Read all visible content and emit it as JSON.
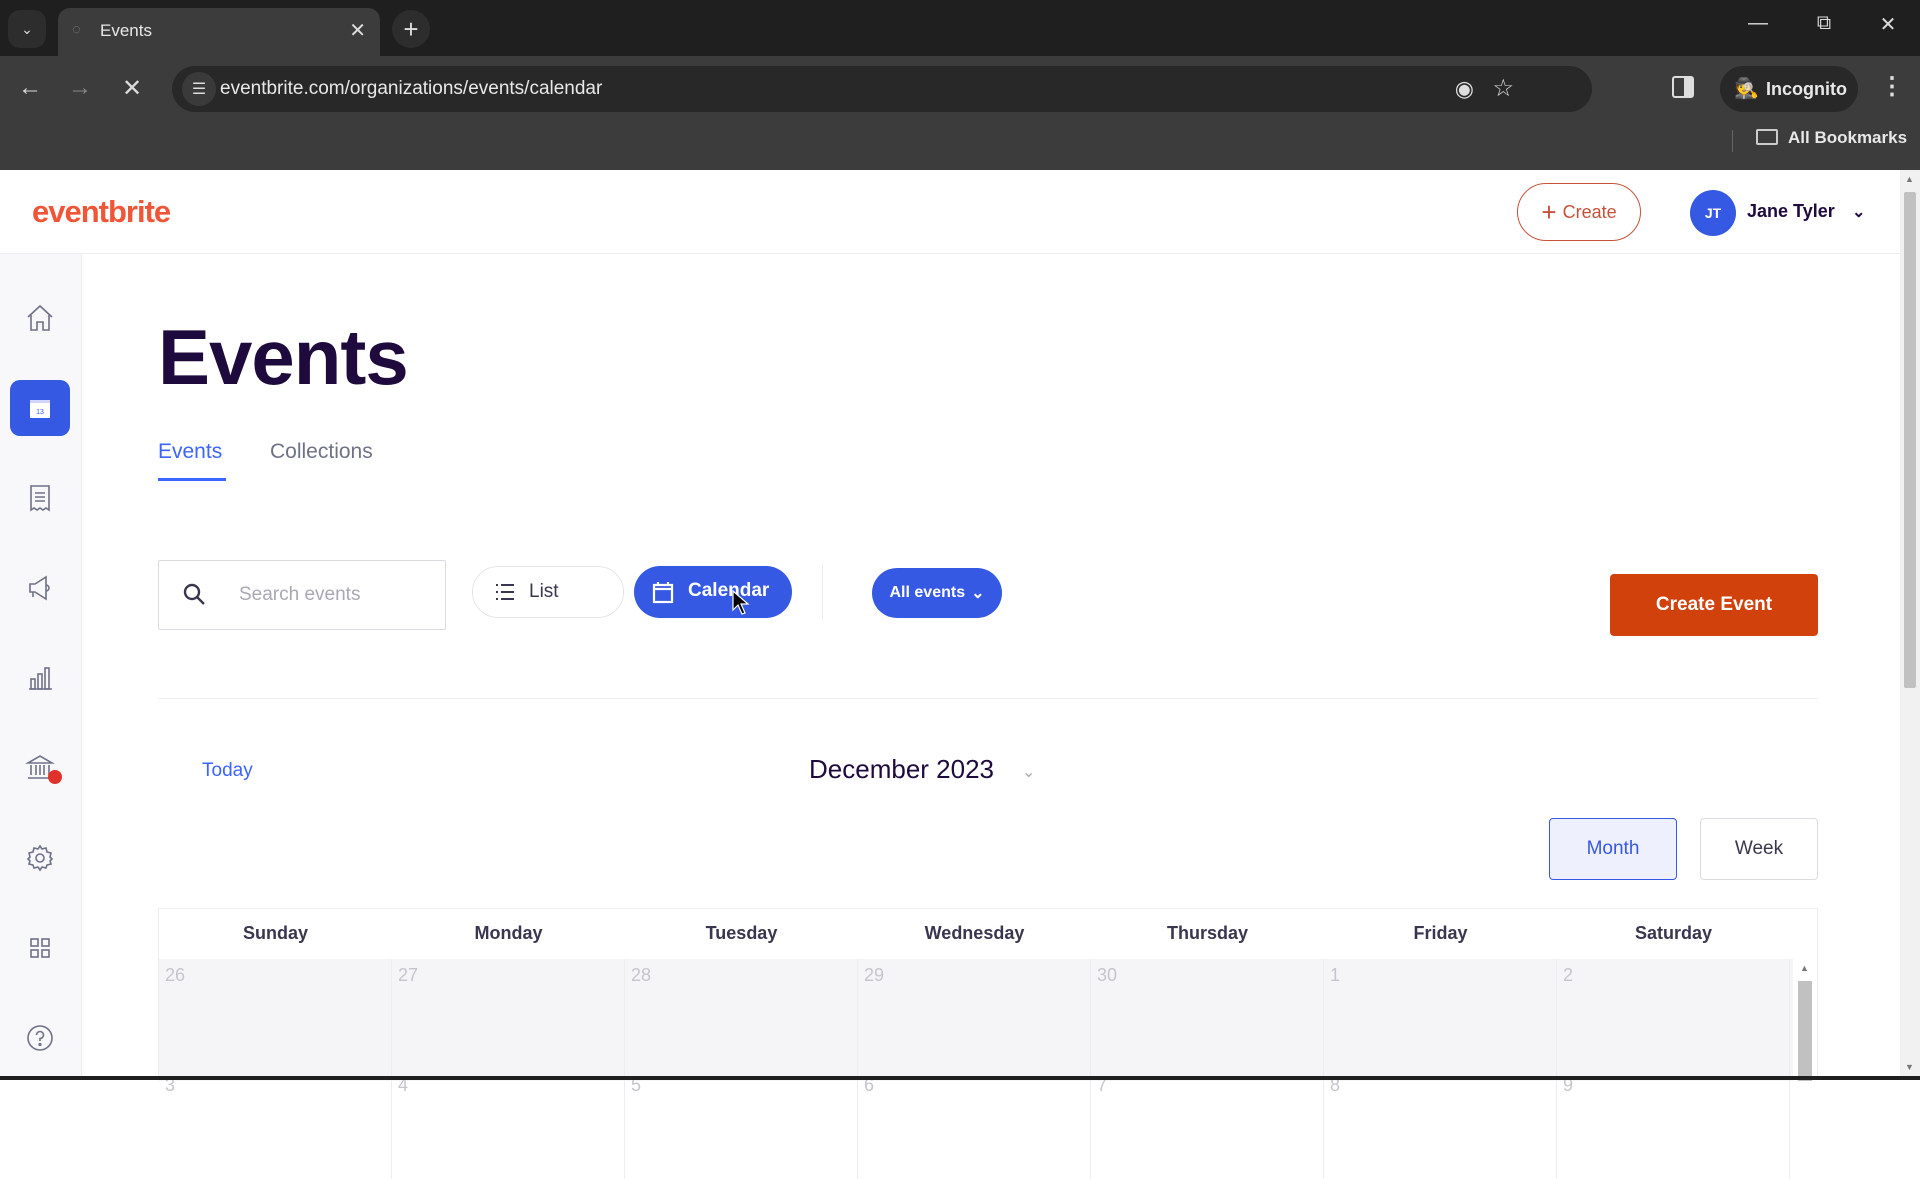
{
  "browser": {
    "tab_title": "Events",
    "url": "eventbrite.com/organizations/events/calendar",
    "profile_label": "Incognito",
    "bookmarks_label": "All Bookmarks"
  },
  "header": {
    "logo": "eventbrite",
    "create_label": "Create",
    "user_initials": "JT",
    "user_name": "Jane Tyler"
  },
  "sidebar": {
    "items": [
      {
        "name": "home",
        "icon": "home-icon",
        "active": false
      },
      {
        "name": "events",
        "icon": "calendar-icon",
        "active": true,
        "icon_text": "13"
      },
      {
        "name": "orders",
        "icon": "receipt-icon",
        "active": false
      },
      {
        "name": "marketing",
        "icon": "megaphone-icon",
        "active": false
      },
      {
        "name": "reporting",
        "icon": "bar-chart-icon",
        "active": false
      },
      {
        "name": "finance",
        "icon": "bank-icon",
        "active": false,
        "notification": true
      },
      {
        "name": "settings",
        "icon": "gear-icon",
        "active": false
      },
      {
        "name": "apps",
        "icon": "grid-icon",
        "active": false
      },
      {
        "name": "help",
        "icon": "help-icon",
        "active": false
      }
    ]
  },
  "main": {
    "title": "Events",
    "tabs": [
      {
        "label": "Events",
        "active": true
      },
      {
        "label": "Collections",
        "active": false
      }
    ],
    "search": {
      "placeholder": "Search events",
      "value": ""
    },
    "view_toggle": {
      "list_label": "List",
      "calendar_label": "Calendar",
      "selected": "Calendar"
    },
    "filter": {
      "label": "All events"
    },
    "create_event_label": "Create Event",
    "calendar": {
      "today_label": "Today",
      "month_label": "December 2023",
      "views": [
        {
          "label": "Month",
          "selected": true
        },
        {
          "label": "Week",
          "selected": false
        }
      ],
      "weekdays": [
        "Sunday",
        "Monday",
        "Tuesday",
        "Wednesday",
        "Thursday",
        "Friday",
        "Saturday"
      ],
      "weeks": [
        [
          "26",
          "27",
          "28",
          "29",
          "30",
          "1",
          "2"
        ],
        [
          "3",
          "4",
          "5",
          "6",
          "7",
          "8",
          "9"
        ]
      ]
    }
  },
  "colors": {
    "brand_orange": "#f05537",
    "primary_blue": "#3659e3",
    "create_event_bg": "#d1410c",
    "title_navy": "#1e0a3c"
  }
}
